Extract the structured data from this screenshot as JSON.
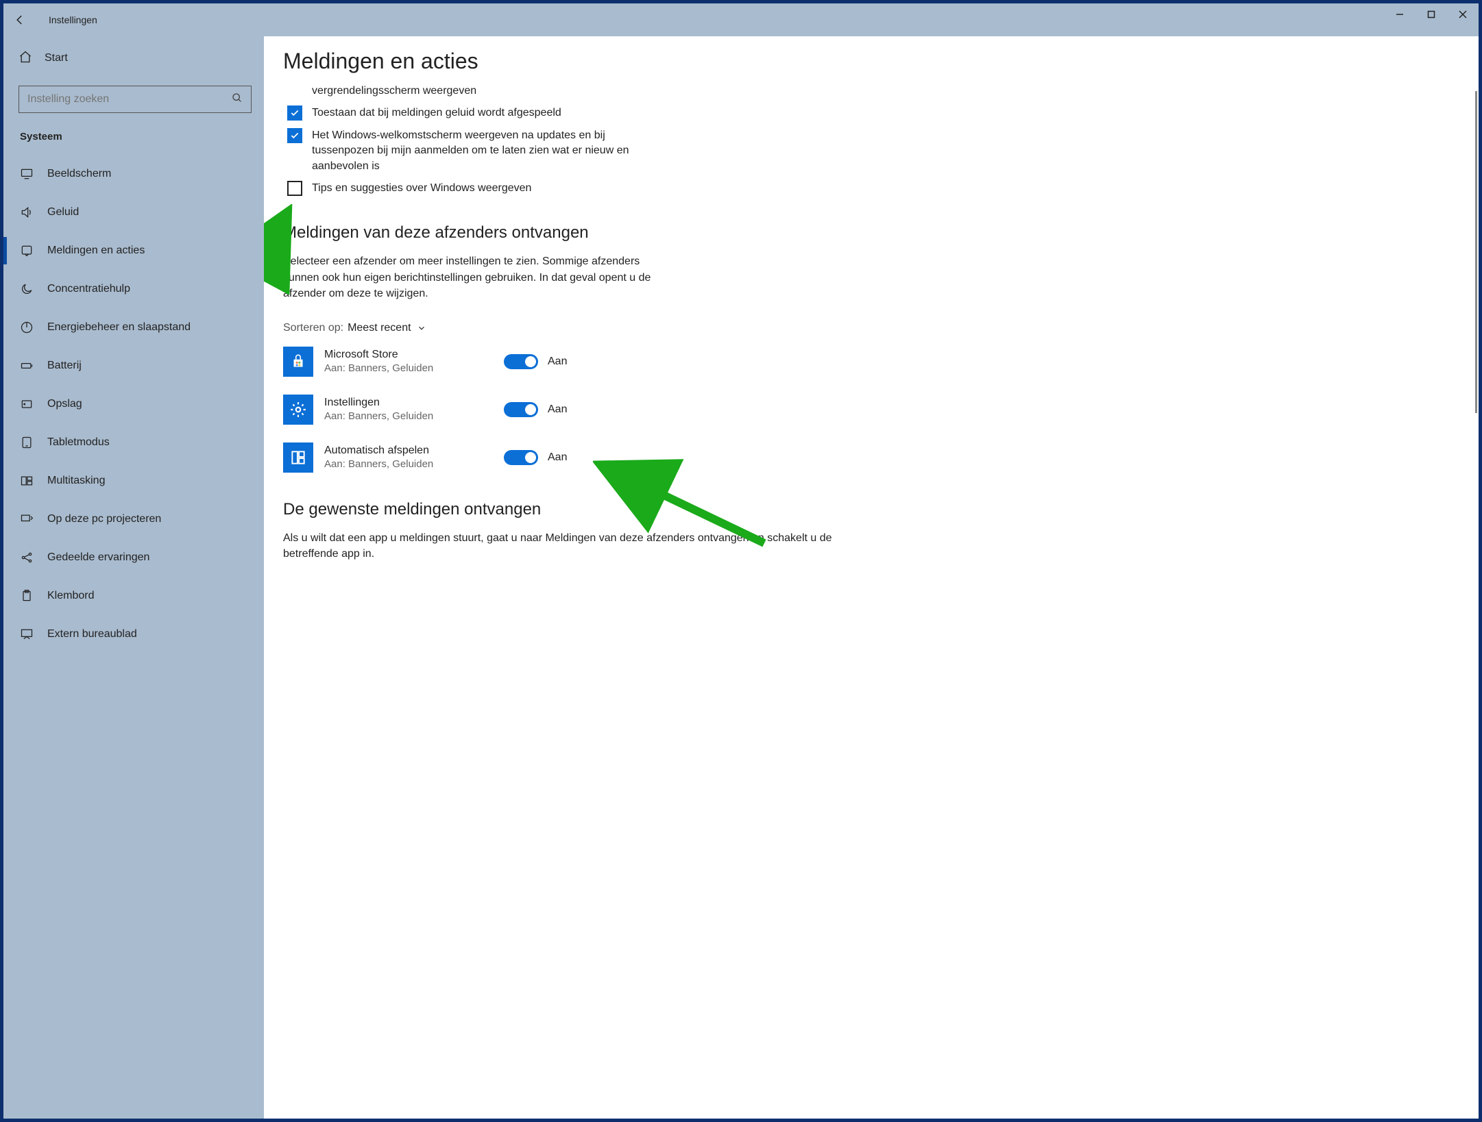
{
  "titlebar": {
    "title": "Instellingen"
  },
  "sidebar": {
    "home": "Start",
    "search_placeholder": "Instelling zoeken",
    "section": "Systeem",
    "items": [
      {
        "icon": "display",
        "label": "Beeldscherm"
      },
      {
        "icon": "sound",
        "label": "Geluid"
      },
      {
        "icon": "notify",
        "label": "Meldingen en acties",
        "active": true
      },
      {
        "icon": "moon",
        "label": "Concentratiehulp"
      },
      {
        "icon": "power",
        "label": "Energiebeheer en slaapstand"
      },
      {
        "icon": "battery",
        "label": "Batterij"
      },
      {
        "icon": "storage",
        "label": "Opslag"
      },
      {
        "icon": "tablet",
        "label": "Tabletmodus"
      },
      {
        "icon": "multitask",
        "label": "Multitasking"
      },
      {
        "icon": "project",
        "label": "Op deze pc projecteren"
      },
      {
        "icon": "shared",
        "label": "Gedeelde ervaringen"
      },
      {
        "icon": "clipboard",
        "label": "Klembord"
      },
      {
        "icon": "remote",
        "label": "Extern bureaublad"
      }
    ]
  },
  "main": {
    "heading": "Meldingen en acties",
    "checks": [
      {
        "checked": true,
        "label": "vergrendelingsscherm weergeven"
      },
      {
        "checked": true,
        "label": "Toestaan dat bij meldingen geluid wordt afgespeeld"
      },
      {
        "checked": true,
        "label": "Het Windows-welkomstscherm weergeven na updates en bij tussenpozen bij mijn aanmelden om te laten zien wat er nieuw en aanbevolen is"
      },
      {
        "checked": false,
        "label": "Tips en suggesties over Windows weergeven"
      }
    ],
    "senders_heading": "Meldingen van deze afzenders ontvangen",
    "senders_desc": "Selecteer een afzender om meer instellingen te zien. Sommige afzenders kunnen ook hun eigen berichtinstellingen gebruiken. In dat geval opent u de afzender om deze te wijzigen.",
    "sort_label": "Sorteren op:",
    "sort_value": "Meest recent",
    "toggle_on_label": "Aan",
    "senders": [
      {
        "icon": "store",
        "name": "Microsoft Store",
        "sub": "Aan: Banners, Geluiden"
      },
      {
        "icon": "gear",
        "name": "Instellingen",
        "sub": "Aan: Banners, Geluiden"
      },
      {
        "icon": "autoplay",
        "name": "Automatisch afspelen",
        "sub": "Aan: Banners, Geluiden"
      }
    ],
    "footer_heading": "De gewenste meldingen ontvangen",
    "footer_desc": "Als u wilt dat een app u meldingen stuurt, gaat u naar Meldingen van deze afzenders ontvangen en schakelt u de betreffende app in."
  }
}
